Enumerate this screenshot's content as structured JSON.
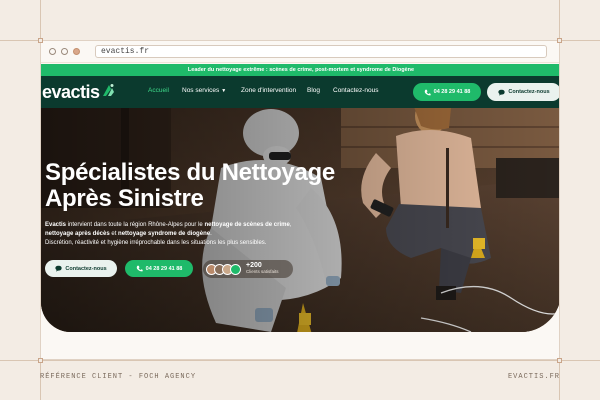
{
  "browser": {
    "url": "evactis.fr"
  },
  "banner": {
    "text": "Leader du nettoyage extrême : scènes de crime, post-mortem et syndrome de Diogène"
  },
  "nav": {
    "logo": "evactis",
    "items": [
      {
        "label": "Accueil",
        "active": true
      },
      {
        "label": "Nos services",
        "dropdown": true
      },
      {
        "label": "Zone d'intervention"
      },
      {
        "label": "Blog"
      },
      {
        "label": "Contactez-nous"
      }
    ],
    "phone_button": "04 28 29 41 88",
    "contact_button": "Contactez-nous"
  },
  "hero": {
    "title_line1": "Spécialistes du Nettoyage",
    "title_line2": "Après Sinistre",
    "desc_brand": "Evactis",
    "desc_part1": " intervient dans toute la région Rhône-Alpes pour le ",
    "desc_bold1": "nettoyage de scènes de crime",
    "desc_part2": ",",
    "desc_bold2": "nettoyage après décès",
    "desc_part3": " et ",
    "desc_bold3": "nettoyage syndrome de diogène",
    "desc_part4": ".",
    "desc_line2": "Discrétion, réactivité et hygiène irréprochable dans les situations les plus sensibles.",
    "contact_button": "Contactez-nous",
    "phone_button": "04 28 29 41 88",
    "clients_count": "+200",
    "clients_label": "Clients satisfaits"
  },
  "footer": {
    "left": "RÉFÉRENCE CLIENT - FOCH AGENCY",
    "right": "EVACTIS.FR"
  },
  "colors": {
    "green": "#1fba6a",
    "dark_green": "#0b3a2e",
    "background": "#f3ece4"
  }
}
